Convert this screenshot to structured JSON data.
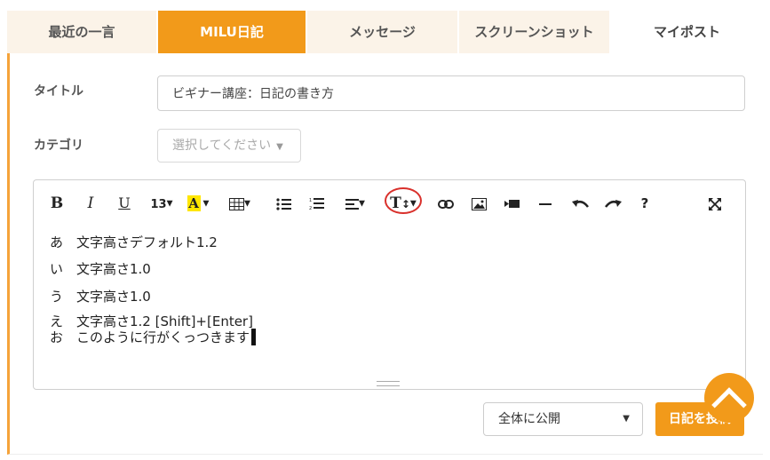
{
  "tabs": [
    {
      "label": "最近の一言"
    },
    {
      "label": "MILU日記"
    },
    {
      "label": "メッセージ"
    },
    {
      "label": "スクリーンショット"
    },
    {
      "label": "マイポスト"
    }
  ],
  "form": {
    "title_label": "タイトル",
    "title_value": "ビギナー講座：日記の書き方",
    "category_label": "カテゴリ",
    "category_placeholder": "選択してください"
  },
  "toolbar": {
    "bold": "B",
    "italic": "I",
    "underline": "U",
    "font_size": "13",
    "highlight": "A",
    "help": "?"
  },
  "content": [
    {
      "kana": "あ",
      "text": "文字高さデフォルト1.2"
    },
    {
      "kana": "い",
      "text": "文字高さ1.0"
    },
    {
      "kana": "う",
      "text": "文字高さ1.0"
    },
    {
      "kana": "え",
      "text": "文字高さ1.2 [Shift]+[Enter]"
    },
    {
      "kana": "お",
      "text": "このように行がくっつきます"
    }
  ],
  "visibility": {
    "value": "全体に公開"
  },
  "post_button": "日記を投稿",
  "colors": {
    "accent": "#f29a1a",
    "annotation": "#d9302b"
  }
}
